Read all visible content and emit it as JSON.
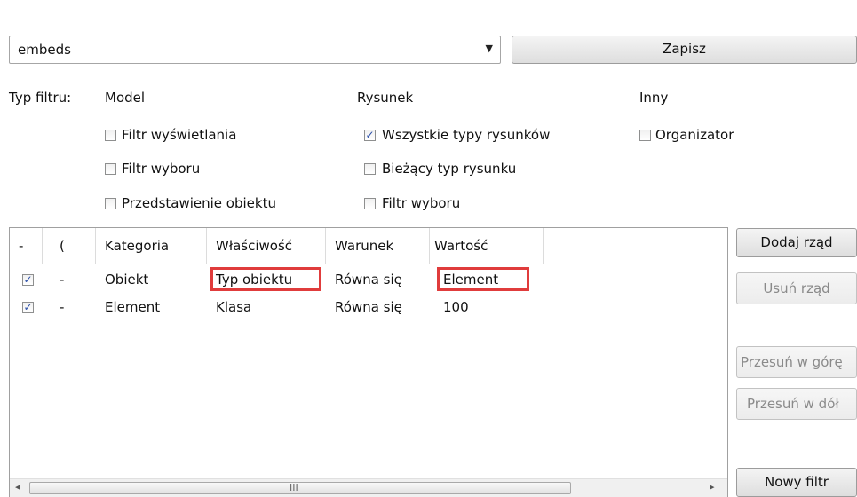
{
  "filter_combo": {
    "value": "embeds",
    "arrow_icon": "dropdown-arrow-icon"
  },
  "save_button": "Zapisz",
  "filter_type": {
    "label": "Typ filtru:",
    "model": {
      "heading": "Model",
      "options": [
        {
          "label": "Filtr wyświetlania",
          "checked": false
        },
        {
          "label": "Filtr wyboru",
          "checked": false
        },
        {
          "label": "Przedstawienie obiektu",
          "checked": false
        }
      ]
    },
    "drawing": {
      "heading": "Rysunek",
      "options": [
        {
          "label": "Wszystkie typy rysunków",
          "checked": true
        },
        {
          "label": "Bieżący typ rysunku",
          "checked": false
        },
        {
          "label": "Filtr wyboru",
          "checked": false
        }
      ]
    },
    "other": {
      "heading": "Inny",
      "options": [
        {
          "label": "Organizator",
          "checked": false
        }
      ]
    }
  },
  "grid": {
    "columns": [
      "-",
      "(",
      "Kategoria",
      "Właściwość",
      "Warunek",
      "Wartość"
    ],
    "rows": [
      {
        "checked": true,
        "paren": "-",
        "category": "Obiekt",
        "property": "Typ obiektu",
        "condition": "Równa się",
        "value": "Element",
        "highlighted": true
      },
      {
        "checked": true,
        "paren": "-",
        "category": "Element",
        "property": "Klasa",
        "condition": "Równa się",
        "value": "100",
        "highlighted": false
      }
    ],
    "scroll": {
      "left_icon": "scroll-left-icon",
      "right_icon": "scroll-right-icon",
      "grip": "III"
    }
  },
  "side_buttons": {
    "add_row": "Dodaj rząd",
    "remove_row": "Usuń rząd",
    "move_up": "Przesuń w górę",
    "move_down": "Przesuń w dół",
    "new_filter": "Nowy filtr"
  },
  "colors": {
    "highlight": "#e03c3c",
    "check_mark": "#2a4ea8"
  }
}
